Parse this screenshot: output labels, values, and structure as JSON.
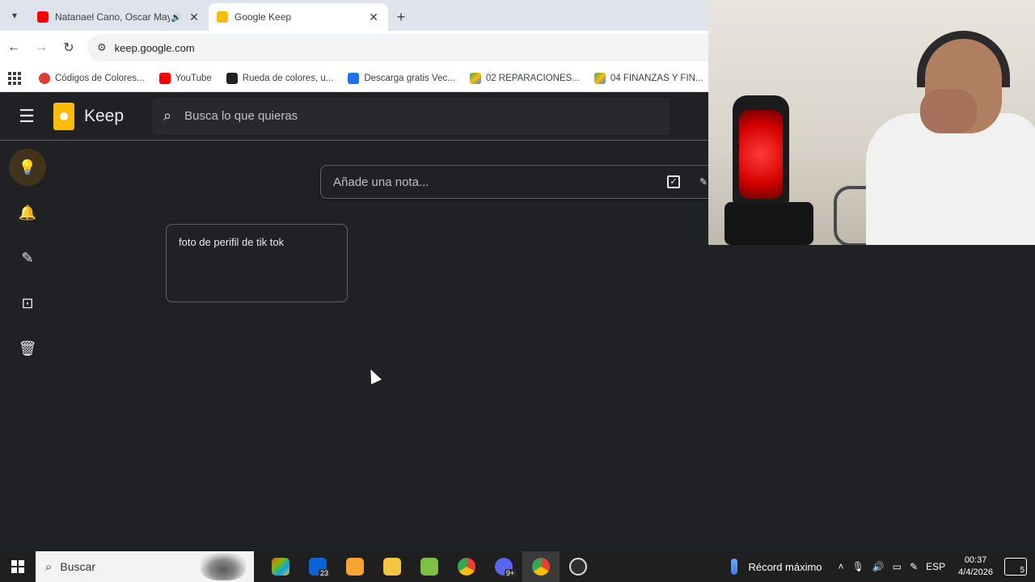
{
  "browser": {
    "tabs": [
      {
        "title": "Natanael Cano, Oscar Mayo",
        "favicon_color": "#ff0000",
        "active": false
      },
      {
        "title": "Google Keep",
        "favicon_color": "#fbbc04",
        "active": true
      }
    ],
    "url": "keep.google.com",
    "bookmarks": [
      {
        "label": "Códigos de Colores...",
        "color": "#e53935"
      },
      {
        "label": "YouTube",
        "color": "#ff0000"
      },
      {
        "label": "Rueda de colores, u...",
        "color": "#222222"
      },
      {
        "label": "Descarga gratis Vec...",
        "color": "#1a73e8"
      },
      {
        "label": "02 REPARACIONES...",
        "color": "#34a853"
      },
      {
        "label": "04 FINANZAS Y FIN...",
        "color": "#34a853"
      }
    ]
  },
  "keep": {
    "app_name": "Keep",
    "search_placeholder": "Busca lo que quieras",
    "note_placeholder": "Añade una nota...",
    "notes": [
      {
        "text": "foto de perifil de tik tok"
      }
    ]
  },
  "taskbar": {
    "search_placeholder": "Buscar",
    "mail_badge": "23",
    "discord_badge": "9+",
    "weather_text": "Récord máximo",
    "language": "ESP",
    "time": "00:37",
    "date": "4/4/2026",
    "notification_count": "5"
  },
  "colors": {
    "keep_bg": "#202124",
    "keep_accent": "#fbbc04",
    "active_sidebar": "#41331c"
  }
}
